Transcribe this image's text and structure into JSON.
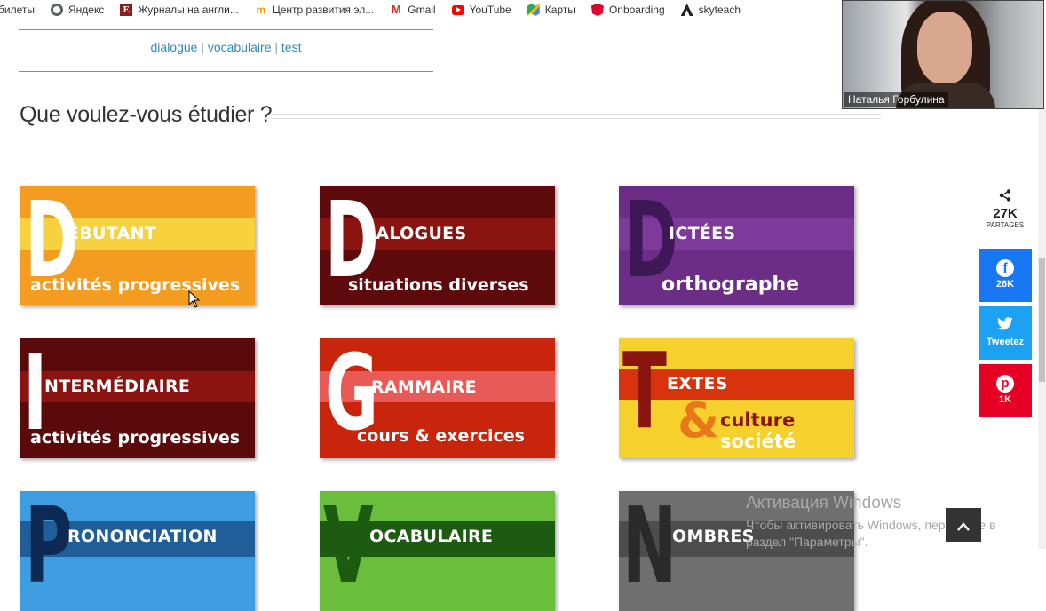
{
  "bookmarks": [
    {
      "label": "билеты",
      "icon": "none"
    },
    {
      "label": "Яндекс",
      "icon": "globe-icon"
    },
    {
      "label": "Журналы на англи...",
      "icon": "e-icon"
    },
    {
      "label": "Центр развития эл...",
      "icon": "m-icon"
    },
    {
      "label": "Gmail",
      "icon": "gmail-icon"
    },
    {
      "label": "YouTube",
      "icon": "youtube-icon"
    },
    {
      "label": "Карты",
      "icon": "maps-icon"
    },
    {
      "label": "Onboarding",
      "icon": "angular-icon"
    },
    {
      "label": "skyteach",
      "icon": "skyteach-icon"
    }
  ],
  "nav_links": {
    "l1": "dialogue",
    "sep1": " | ",
    "l2": "vocabulaire",
    "sep2": " | ",
    "l3": "test"
  },
  "heading": "Que voulez-vous étudier ?",
  "tiles": [
    {
      "letter": "D",
      "line1": "ÉBUTANT",
      "line2": "activités progressives",
      "bg": "#f39c1f",
      "band": "#f7d23e",
      "letter_color": "#ffffff"
    },
    {
      "letter": "D",
      "line1": "IALOGUES",
      "line2": "situations diverses",
      "bg": "#5e0a0c",
      "band": "#8a1410",
      "letter_color": "#ffffff"
    },
    {
      "letter": "D",
      "line1": "ICTÉES",
      "line2": "orthographe",
      "bg": "#6b2d86",
      "band": "#7d3a9a",
      "letter_color": "#3d1756"
    },
    {
      "letter": "I",
      "line1": "NTERMÉDIAIRE",
      "line2": "activités progressives",
      "bg": "#5a0a0b",
      "band": "#8b1410",
      "letter_color": "#ffffff"
    },
    {
      "letter": "G",
      "line1": "RAMMAIRE",
      "line2": "cours & exercices",
      "bg": "#c9240c",
      "band": "#e85a55",
      "letter_color": "#ffffff"
    },
    {
      "letter": "T",
      "line1": "EXTES",
      "line2a": "culture",
      "line2b": "société",
      "amp": "&",
      "bg": "#f6d12e",
      "band": "#d9330e",
      "letter_color": "#8a1410"
    },
    {
      "letter": "P",
      "line1": "RONONCIATION",
      "bg": "#3d9de0",
      "band": "#1f5e99",
      "letter_color": "#0d2a55"
    },
    {
      "letter": "V",
      "line1": "OCABULAIRE",
      "bg": "#6bbd3c",
      "band": "#1d5c10",
      "letter_color": "#1d5c10"
    },
    {
      "letter": "N",
      "line1": "OMBRES",
      "bg": "#6f6f6f",
      "band": "#4d4d4d",
      "letter_color": "#2a2a2a"
    }
  ],
  "share": {
    "count": "27K",
    "label": "PARTAGES",
    "facebook": "26K",
    "twitter": "Tweetez",
    "pinterest": "1K"
  },
  "webcam": {
    "name": "Наталья Горбулина"
  },
  "watermark": {
    "line1": "Активация Windows",
    "line2": "Чтобы активировать Windows, перейдите в",
    "line3": "раздел \"Параметры\"."
  },
  "colors": {
    "link": "#2e8ab8",
    "facebook": "#1877f2",
    "twitter": "#1da1f2",
    "pinterest": "#e60023"
  }
}
